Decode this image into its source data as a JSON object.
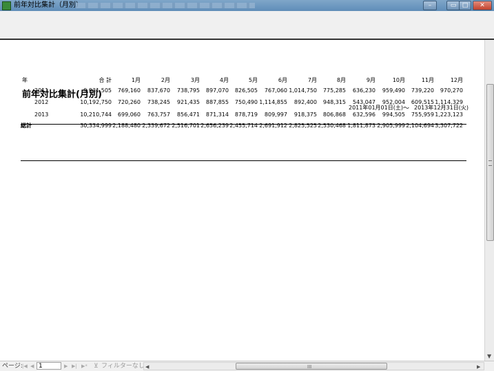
{
  "window": {
    "title": "前年対比集計（月別）"
  },
  "report": {
    "title": "前年対比集計(月別)",
    "date_from": "2011年01月01日(土)",
    "tilde": "～",
    "date_to": "2013年12月31日(火)",
    "columns": [
      "年",
      "合 計",
      "1月",
      "2月",
      "3月",
      "4月",
      "5月",
      "6月",
      "7月",
      "8月",
      "9月",
      "10月",
      "11月",
      "12月"
    ],
    "rows": [
      {
        "year": "2011",
        "values": [
          "9,931,505",
          "769,160",
          "837,670",
          "738,795",
          "897,070",
          "826,505",
          "767,060",
          "1,014,750",
          "775,285",
          "636,230",
          "959,490",
          "739,220",
          "970,270"
        ]
      },
      {
        "year": "2012",
        "values": [
          "10,192,750",
          "720,260",
          "738,245",
          "921,435",
          "887,855",
          "750,490",
          "1,114,855",
          "892,400",
          "948,315",
          "543,047",
          "952,004",
          "609,515",
          "1,114,329"
        ]
      },
      {
        "year": "2013",
        "values": [
          "10,210,744",
          "699,060",
          "763,757",
          "856,471",
          "871,314",
          "878,719",
          "809,997",
          "918,375",
          "806,868",
          "632,596",
          "994,505",
          "755,959",
          "1,223,123"
        ]
      }
    ],
    "total": {
      "label": "総計",
      "values": [
        "30,334,999",
        "2,188,480",
        "2,339,672",
        "2,516,701",
        "2,656,239",
        "2,455,714",
        "2,691,912",
        "2,825,525",
        "2,530,468",
        "1,811,873",
        "2,905,999",
        "2,104,694",
        "3,307,722"
      ]
    }
  },
  "statusbar": {
    "page_label": "ページ:",
    "nav_first": "|◀",
    "nav_prev": "◀",
    "page_value": "1",
    "nav_next": "▶",
    "nav_last": "▶|",
    "nav_new": "▶*",
    "filter_label": "フィルターなし",
    "hscroll_left": "◀",
    "hscroll_grip": "III",
    "hscroll_right": "▶"
  },
  "icons": {
    "app": "access-report-icon",
    "filter": "funnel-icon"
  }
}
